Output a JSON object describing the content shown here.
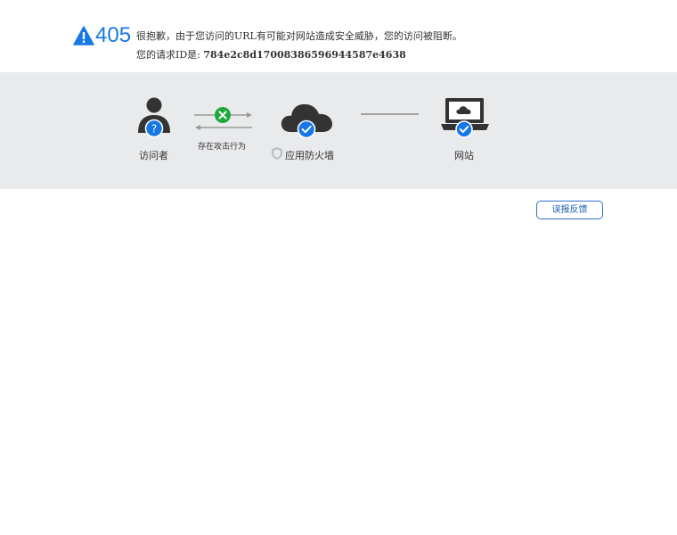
{
  "error": {
    "code": "405",
    "message": "很抱歉，由于您访问的URL有可能对网站造成安全威胁，您的访问被阻断。",
    "request_id_label": "您的请求ID是:",
    "request_id": "784e2c8d17008386596944587e4638"
  },
  "flow": {
    "visitor_label": "访问者",
    "attack_label": "存在攻击行为",
    "waf_label": "应用防火墙",
    "website_label": "网站"
  },
  "feedback_button": "误报反馈",
  "colors": {
    "accent": "#1677e6",
    "band": "#e9eaec",
    "block_green": "#1ea83c",
    "icon_dark": "#333333"
  }
}
